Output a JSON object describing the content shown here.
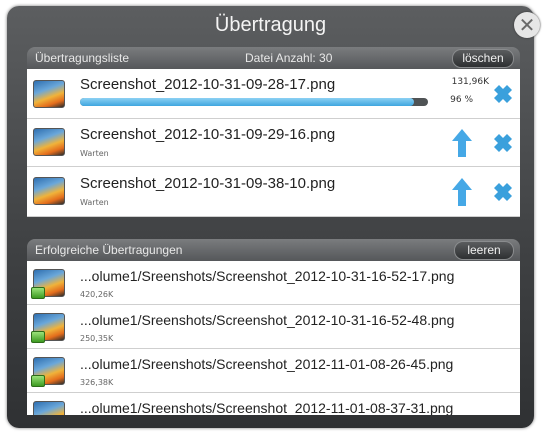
{
  "dialog": {
    "title": "Übertragung"
  },
  "queue": {
    "header_label": "Übertragungsliste",
    "count_label": "Datei Anzahl: 30",
    "clear_button": "löschen",
    "items": [
      {
        "filename": "Screenshot_2012-10-31-09-28-17.png",
        "size": "131,96K",
        "percent": "96 %",
        "progress": 0.96
      },
      {
        "filename": "Screenshot_2012-10-31-09-29-16.png",
        "status": "Warten"
      },
      {
        "filename": "Screenshot_2012-10-31-09-38-10.png",
        "status": "Warten"
      }
    ]
  },
  "completed": {
    "header_label": "Erfolgreiche Übertragungen",
    "clear_button": "leeren",
    "items": [
      {
        "path": "...olume1/Sreenshots/Screenshot_2012-10-31-16-52-17.png",
        "size": "420,26K"
      },
      {
        "path": "...olume1/Sreenshots/Screenshot_2012-10-31-16-52-48.png",
        "size": "250,35K"
      },
      {
        "path": "...olume1/Sreenshots/Screenshot_2012-11-01-08-26-45.png",
        "size": "326,38K"
      },
      {
        "path": "...olume1/Sreenshots/Screenshot_2012-11-01-08-37-31.png",
        "size": ""
      }
    ]
  },
  "colors": {
    "accent": "#3fa6df",
    "dialog_bg": "#3e4042"
  },
  "icons": {
    "upload": "arrow-up-icon",
    "cancel": "close-x-icon",
    "close": "close-icon",
    "file": "image-file-icon"
  }
}
